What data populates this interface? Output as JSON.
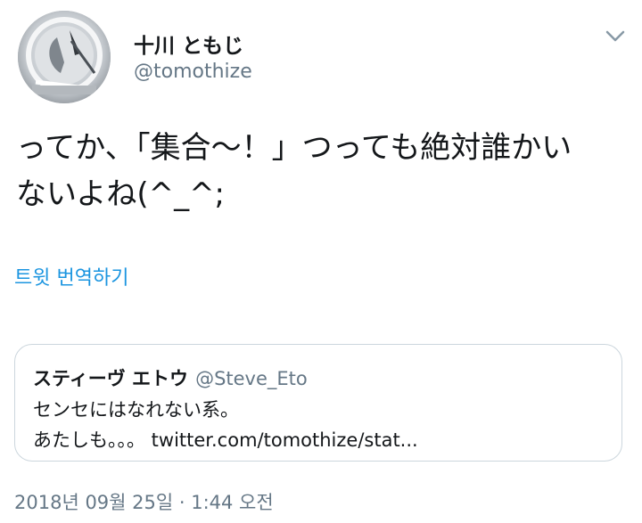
{
  "author": {
    "display_name": "十川 ともじ",
    "handle": "@tomothize",
    "avatar_icon": "avatar-clock-image"
  },
  "menu": {
    "icon": "chevron-down-icon"
  },
  "tweet": {
    "lines": [
      "ってか、「集合〜！」つっても絶対誰かい",
      "ないよね(^_^;"
    ],
    "translate_label": "트윗 번역하기",
    "timestamp": "2018년 09월 25일 · 1:44 오전"
  },
  "quoted_tweet": {
    "display_name": "スティーヴ エトウ",
    "handle": "@Steve_Eto",
    "lines": [
      "センセにはなれない系。",
      "あたしも。。。 twitter.com/tomothize/stat..."
    ]
  },
  "colors": {
    "text_primary": "#14171a",
    "text_secondary": "#657786",
    "link_blue": "#1b95e0",
    "card_border": "#ccd6dd"
  }
}
